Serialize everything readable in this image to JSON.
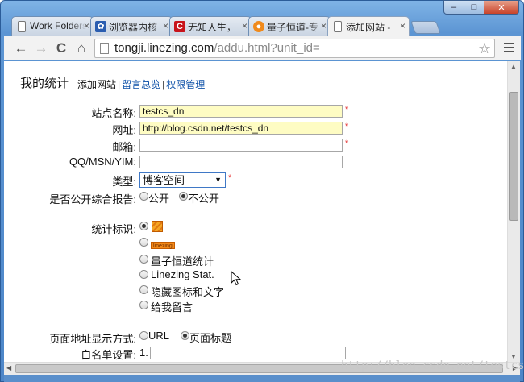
{
  "window": {
    "controls": {
      "minimize": "–",
      "maximize": "□",
      "close": "✕"
    }
  },
  "tabs": [
    {
      "title": "Work Folders",
      "icon": "document-icon",
      "close": "×"
    },
    {
      "title": "浏览器内核",
      "icon": "paw-icon",
      "close": "×"
    },
    {
      "title": "无知人生，",
      "icon": "csdn-icon",
      "close": "×"
    },
    {
      "title": "量子恒道-专",
      "icon": "orange-logo-icon",
      "close": "×"
    },
    {
      "title": "添加网站 - ",
      "icon": "document-icon",
      "close": "×",
      "active": true
    }
  ],
  "toolbar": {
    "back": "←",
    "forward": "→",
    "reload": "C",
    "home": "⌂",
    "url_host": "tongji.linezing.com",
    "url_path": "/addu.html?unit_id=",
    "star": "☆"
  },
  "page": {
    "heading": "我的统计",
    "links": [
      {
        "label": "添加网站",
        "current": true
      },
      {
        "label": "留言总览",
        "current": false
      },
      {
        "label": "权限管理",
        "current": false
      }
    ],
    "link_separator": "|",
    "form": {
      "site_name_label": "站点名称:",
      "site_name_value": "testcs_dn",
      "url_label": "网址:",
      "url_value": "http://blog.csdn.net/testcs_dn",
      "email_label": "邮箱:",
      "email_value": "",
      "im_label": "QQ/MSN/YIM:",
      "im_value": "",
      "type_label": "类型:",
      "type_value": "博客空间",
      "required_mark": "*",
      "public_report_label": "是否公开综合报告:",
      "public_report_options": [
        "公开",
        "不公开"
      ],
      "public_report_selected": "不公开",
      "marker_label": "统计标识:",
      "marker_options": [
        "",
        "linezing",
        "量子恒道统计",
        "Linezing Stat.",
        "隐藏图标和文字",
        "给我留言"
      ],
      "marker_selected_index": 0,
      "page_address_label": "页面地址显示方式:",
      "page_address_options": [
        "URL",
        "页面标题"
      ],
      "page_address_selected": "页面标题",
      "whitelist_label": "白名单设置:",
      "whitelist_index": "1.",
      "whitelist_value": ""
    }
  },
  "watermark": "http://blog.csdn.net/testcs_dn"
}
